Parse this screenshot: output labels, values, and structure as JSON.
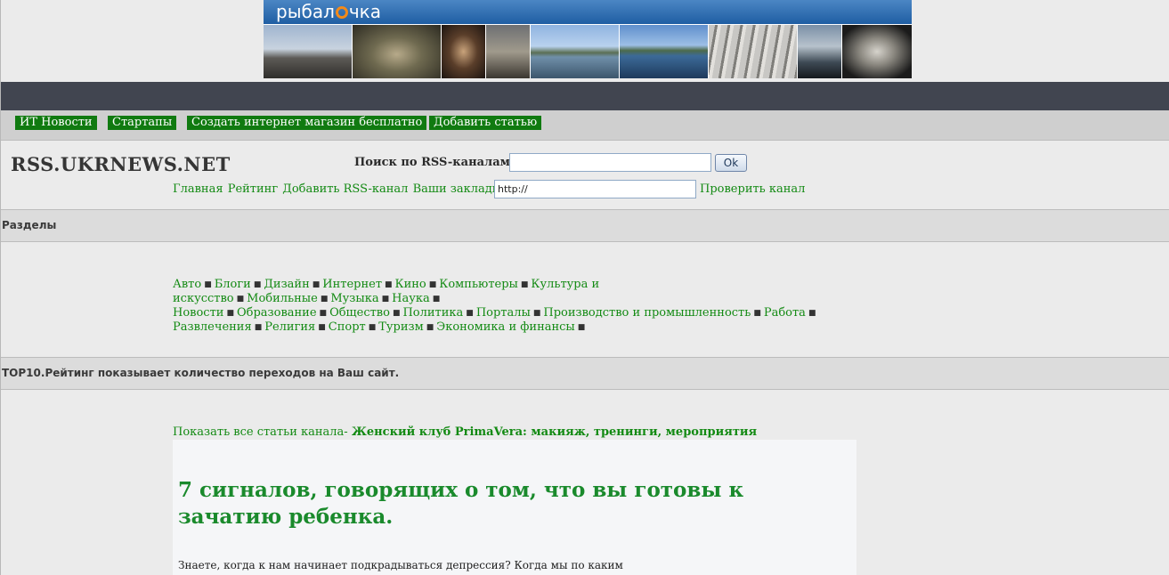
{
  "banner": {
    "logo_text_before": "рыбал",
    "logo_text_after": "чка"
  },
  "nav": {
    "buttons": [
      "ИТ Новости",
      "Стартапы",
      "Создать интернет магазин бесплатно",
      "Добавить статью"
    ]
  },
  "header": {
    "site_title": "RSS.UKRNEWS.NET",
    "search_label": "Поиск по RSS-каналам",
    "search_value": "",
    "ok_label": "Ok",
    "links": [
      "Главная",
      "Рейтинг",
      "Добавить RSS-канал",
      "Ваши закладки"
    ],
    "url_value": "http://",
    "check_link": "Проверить канал"
  },
  "sections": {
    "razdely": "Разделы",
    "top10": "TOP10.Рейтинг показывает количество переходов на Ваш сайт."
  },
  "categories": [
    "Авто",
    "Блоги",
    "Дизайн",
    "Интернет",
    "Кино",
    "Компьютеры",
    "Культура и искусство",
    "Мобильные",
    "Музыка",
    "Наука",
    "Новости",
    "Образование",
    "Общество",
    "Политика",
    "Порталы",
    "Производство и промышленность",
    "Работа",
    "Развлечения",
    "Религия",
    "Спорт",
    "Туризм",
    "Экономика и финансы"
  ],
  "channel": {
    "prefix": "Показать все статьи канала- ",
    "name": "Женский клуб PrimaVera: макияж, тренинги, мероприятия"
  },
  "article": {
    "title": "7 сигналов, говорящих о том, что вы готовы к зачатию ребенка.",
    "excerpt": "Знаете, когда к нам начинает подкрадываться депрессия? Когда мы по каким"
  }
}
